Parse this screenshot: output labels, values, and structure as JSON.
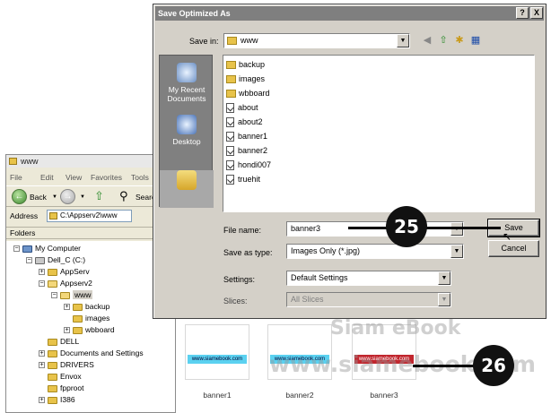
{
  "explorer": {
    "title": "www",
    "menu": [
      "File",
      "Edit",
      "View",
      "Favorites",
      "Tools"
    ],
    "toolbar": {
      "back_label": "Back",
      "search_label": "Search",
      "folders_label": "Folders"
    },
    "address_label": "Address",
    "address_value": "C:\\Appserv2\\www",
    "folders_header": "Folders",
    "tree": [
      {
        "label": "My Computer",
        "pm": "−"
      },
      {
        "label": "Dell_C (C:)",
        "pm": "−"
      },
      {
        "label": "AppServ",
        "pm": "+"
      },
      {
        "label": "Appserv2",
        "pm": "−"
      },
      {
        "label": "www",
        "pm": "−"
      },
      {
        "label": "backup",
        "pm": "+"
      },
      {
        "label": "images",
        "pm": ""
      },
      {
        "label": "wbboard",
        "pm": "+"
      },
      {
        "label": "DELL",
        "pm": ""
      },
      {
        "label": "Documents and Settings",
        "pm": "+"
      },
      {
        "label": "DRIVERS",
        "pm": "+"
      },
      {
        "label": "Envox",
        "pm": ""
      },
      {
        "label": "fpproot",
        "pm": ""
      },
      {
        "label": "I386",
        "pm": "+"
      }
    ]
  },
  "dialog": {
    "title": "Save Optimized As",
    "help_btn": "?",
    "close_btn": "X",
    "save_in_label": "Save in:",
    "save_in_value": "www",
    "places": [
      {
        "label": "My Recent Documents"
      },
      {
        "label": "Desktop"
      }
    ],
    "files": [
      {
        "name": "backup",
        "type": "folder"
      },
      {
        "name": "images",
        "type": "folder"
      },
      {
        "name": "wbboard",
        "type": "folder"
      },
      {
        "name": "about",
        "type": "file"
      },
      {
        "name": "about2",
        "type": "file"
      },
      {
        "name": "banner1",
        "type": "file"
      },
      {
        "name": "banner2",
        "type": "file"
      },
      {
        "name": "hondi007",
        "type": "file"
      },
      {
        "name": "truehit",
        "type": "file"
      }
    ],
    "file_name_label": "File name:",
    "file_name_value": "banner3",
    "save_type_label": "Save as type:",
    "save_type_value": "Images Only (*.jpg)",
    "settings_label": "Settings:",
    "settings_value": "Default Settings",
    "slices_label": "Slices:",
    "slices_value": "All Slices",
    "save_button": "Save",
    "cancel_button": "Cancel"
  },
  "preview": {
    "banners": [
      {
        "caption": "banner1",
        "text": "www.siamebook.com"
      },
      {
        "caption": "banner2",
        "text": "www.siamebook.com"
      },
      {
        "caption": "banner3",
        "text": "www.siamebook.com"
      }
    ]
  },
  "watermark": {
    "line1": "Siam eBook",
    "line2": "www.siamebook.com"
  },
  "callouts": {
    "first": "25",
    "second": "26"
  }
}
